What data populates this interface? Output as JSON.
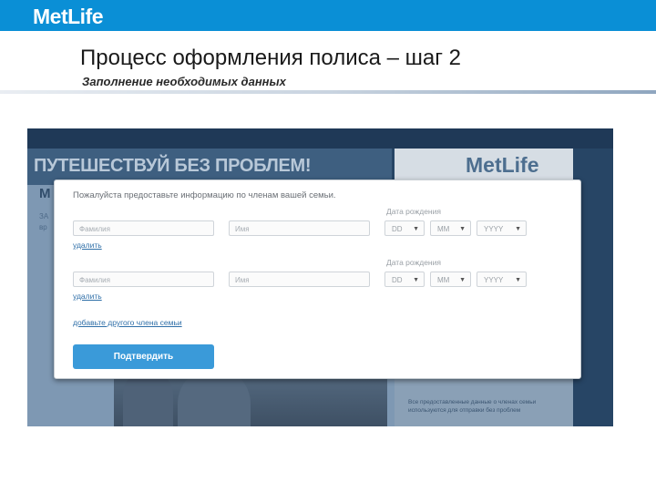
{
  "header": {
    "brand": "MetLife",
    "accent_color": "#0a8fd6"
  },
  "slide": {
    "title": "Процесс оформления полиса – шаг 2",
    "subtitle": "Заполнение необходимых данных"
  },
  "screenshot": {
    "banner": "ПУТЕШЕСТВУЙ БЕЗ ПРОБЛЕМ!",
    "logo": "MetLife",
    "left_heading": "М",
    "left_line1": "ЗА",
    "left_line2": "вр",
    "side_note": "Все предоставленные данные о членах семьи используются для отправки без проблем",
    "modal": {
      "prompt": "Пожалуйста предоставьте информацию по членам вашей семьи.",
      "members": [
        {
          "surname_placeholder": "Фамилия",
          "name_placeholder": "Имя",
          "dob_label": "Дата рождения",
          "day": "DD",
          "month": "MM",
          "year": "YYYY",
          "delete_label": "удалить"
        },
        {
          "surname_placeholder": "Фамилия",
          "name_placeholder": "Имя",
          "dob_label": "Дата рождения",
          "day": "DD",
          "month": "MM",
          "year": "YYYY",
          "delete_label": "удалить"
        }
      ],
      "add_member_label": "добавьте другого члена семьи",
      "submit_label": "Подтвердить",
      "submit_color": "#3a9ad9"
    }
  }
}
